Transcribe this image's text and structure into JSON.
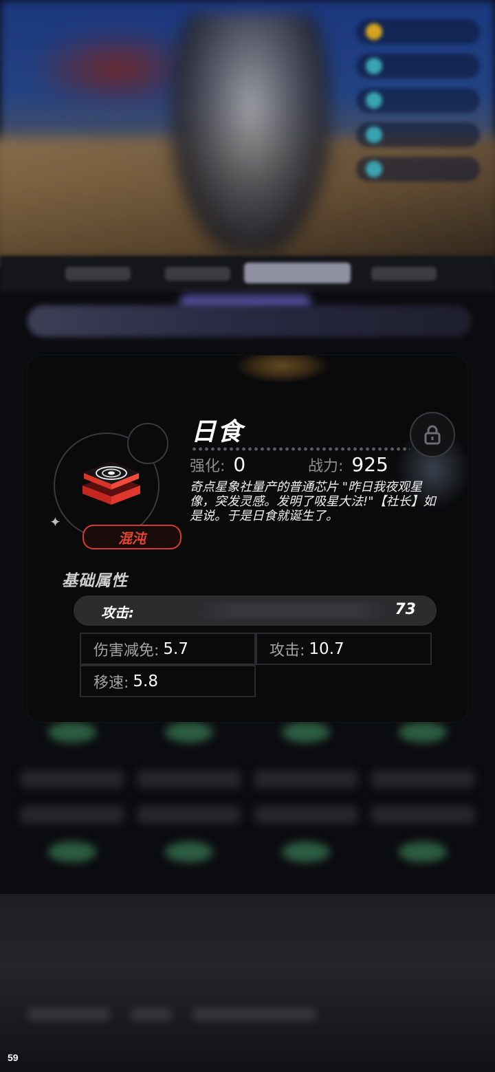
{
  "chip": {
    "name": "日食",
    "rank": "混沌",
    "enhance_label": "强化:",
    "enhance_value": "0",
    "power_label": "战力:",
    "power_value": "925",
    "description": "奇点星象社量产的普通芯片 \"昨日我夜观星像，突发灵感。发明了吸星大法!\"【社长】如是说。于是日食就诞生了。",
    "locked": true
  },
  "attributes": {
    "section_title": "基础属性",
    "main": {
      "label": "攻击:",
      "value": "73"
    },
    "sub": [
      {
        "label": "伤害减免:",
        "value": "5.7"
      },
      {
        "label": "攻击:",
        "value": "10.7"
      },
      {
        "label": "移速:",
        "value": "5.8"
      }
    ]
  },
  "overlay": {
    "fps": "59"
  },
  "colors": {
    "rank_red": "#e4472f",
    "card_bg": "#0a0a0b",
    "chip_red": "#d8352b"
  },
  "icons": {
    "chip": "vortex-chip-icon",
    "lock": "lock-icon",
    "sparkle": "sparkle-icon"
  }
}
